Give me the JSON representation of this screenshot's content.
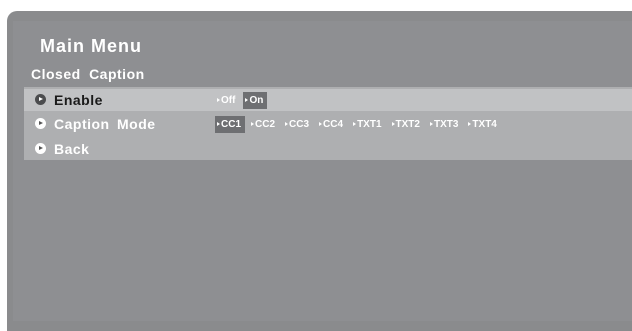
{
  "menu": {
    "title": "Main Menu",
    "subtitle": "Closed  Caption",
    "items": [
      {
        "label": "Enable",
        "options": [
          "Off",
          "On"
        ],
        "selected": "On"
      },
      {
        "label": "Caption  Mode",
        "options": [
          "CC1",
          "CC2",
          "CC3",
          "CC4",
          "TXT1",
          "TXT2",
          "TXT3",
          "TXT4"
        ],
        "selected": "CC1"
      },
      {
        "label": "Back"
      }
    ]
  },
  "colors": {
    "panel_bg": "#8a8b8d",
    "band_bg": "#aeafb1",
    "highlight_row": "#c1c2c4",
    "selected_option": "#6e6f72",
    "text": "#ffffff"
  },
  "icons": {
    "row_bullet": "play-circle-icon",
    "option_marker": "triangle-right-icon"
  }
}
